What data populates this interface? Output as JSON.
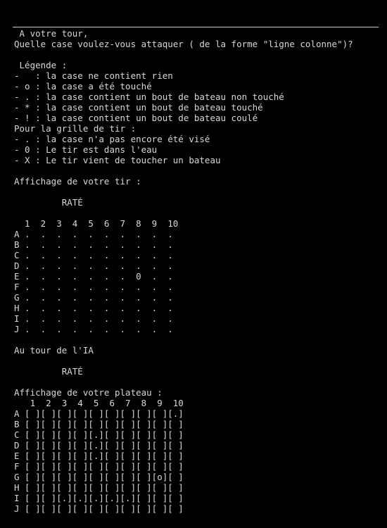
{
  "terminal": {
    "lines": [
      " A votre tour,",
      "Quelle case voulez-vous attaquer ( de la forme \"ligne colonne\")?",
      "",
      " Légende :",
      "-   : la case ne contient rien",
      "- o : la case a été touché",
      "- . : la case contient un bout de bateau non touché",
      "- * : la case contient un bout de bateau touché",
      "- ! : la case contient un bout de bateau coulé",
      "Pour la grille de tir :",
      "- . : la case n'a pas encore été visé",
      "- 0 : Le tir est dans l'eau",
      "- X : Le tir vient de toucher un bateau",
      "",
      "Affichage de votre tir :",
      "",
      "         RATÉ",
      "",
      "  1  2  3  4  5  6  7  8  9  10",
      "A .  .  .  .  .  .  .  .  .  .",
      "B .  .  .  .  .  .  .  .  .  .",
      "C .  .  .  .  .  .  .  .  .  .",
      "D .  .  .  .  .  .  .  .  .  .",
      "E .  .  .  .  .  .  .  0  .  .",
      "F .  .  .  .  .  .  .  .  .  .",
      "G .  .  .  .  .  .  .  .  .  .",
      "H .  .  .  .  .  .  .  .  .  .",
      "I .  .  .  .  .  .  .  .  .  .",
      "J .  .  .  .  .  .  .  .  .  .",
      "",
      "Au tour de l'IA",
      "",
      "         RATÉ",
      "",
      "Affichage de votre plateau :",
      "   1  2  3  4  5  6  7  8  9  10",
      "A [ ][ ][ ][ ][ ][ ][ ][ ][ ][.]",
      "B [ ][ ][ ][ ][ ][ ][ ][ ][ ][ ]",
      "C [ ][ ][ ][ ][.][ ][ ][ ][ ][ ]",
      "D [ ][ ][ ][ ][.][ ][ ][ ][ ][ ]",
      "E [ ][ ][ ][ ][.][ ][ ][ ][ ][ ]",
      "F [ ][ ][ ][ ][ ][ ][ ][ ][ ][ ]",
      "G [ ][ ][ ][ ][ ][ ][ ][ ][o][ ]",
      "H [ ][ ][ ][ ][ ][ ][ ][ ][ ][ ]",
      "I [ ][ ][.][.][.][.][.][ ][ ][ ]",
      "J [ ][ ][ ][ ][ ][ ][ ][ ][ ][ ]"
    ]
  }
}
